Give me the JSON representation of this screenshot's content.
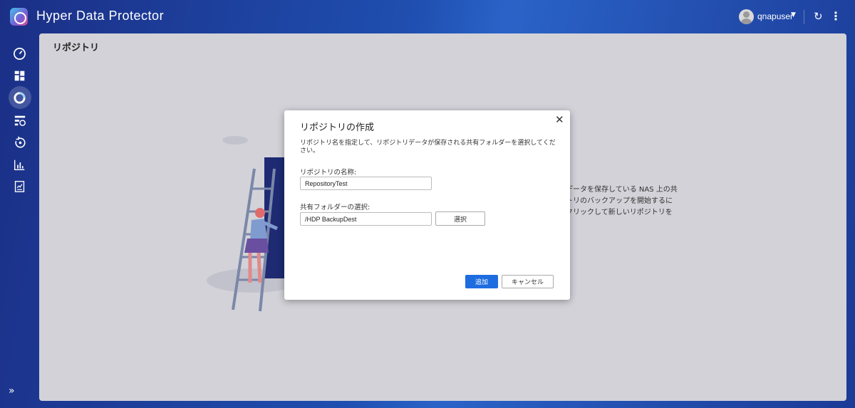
{
  "header": {
    "app_title": "Hyper Data Protector",
    "user_name": "qnapuser"
  },
  "sidebar": {
    "items": [
      {
        "icon": "dashboard-gauge-icon"
      },
      {
        "icon": "overview-grid-icon"
      },
      {
        "icon": "repository-icon",
        "active": true
      },
      {
        "icon": "backup-jobs-icon"
      },
      {
        "icon": "restore-icon"
      },
      {
        "icon": "reports-chart-icon"
      },
      {
        "icon": "logs-icon"
      }
    ]
  },
  "main": {
    "page_title": "リポジトリ",
    "background_text": "データを保存している NAS 上の共\nトリのバックアップを開始するに\nクリックして新しいリポジトリを"
  },
  "dialog": {
    "title": "リポジトリの作成",
    "description": "リポジトリ名を指定して、リポジトリデータが保存される共有フォルダーを選択してください。",
    "name_label": "リポジトリの名称:",
    "name_value": "RepositoryTest",
    "folder_label": "共有フォルダーの選択:",
    "folder_value": "/HDP BackupDest",
    "select_label": "選択",
    "add_label": "追加",
    "cancel_label": "キャンセル"
  },
  "colors": {
    "accent": "#1e6de0",
    "panel": "#d2d2d8",
    "header_bg": "#1f4fb0"
  }
}
